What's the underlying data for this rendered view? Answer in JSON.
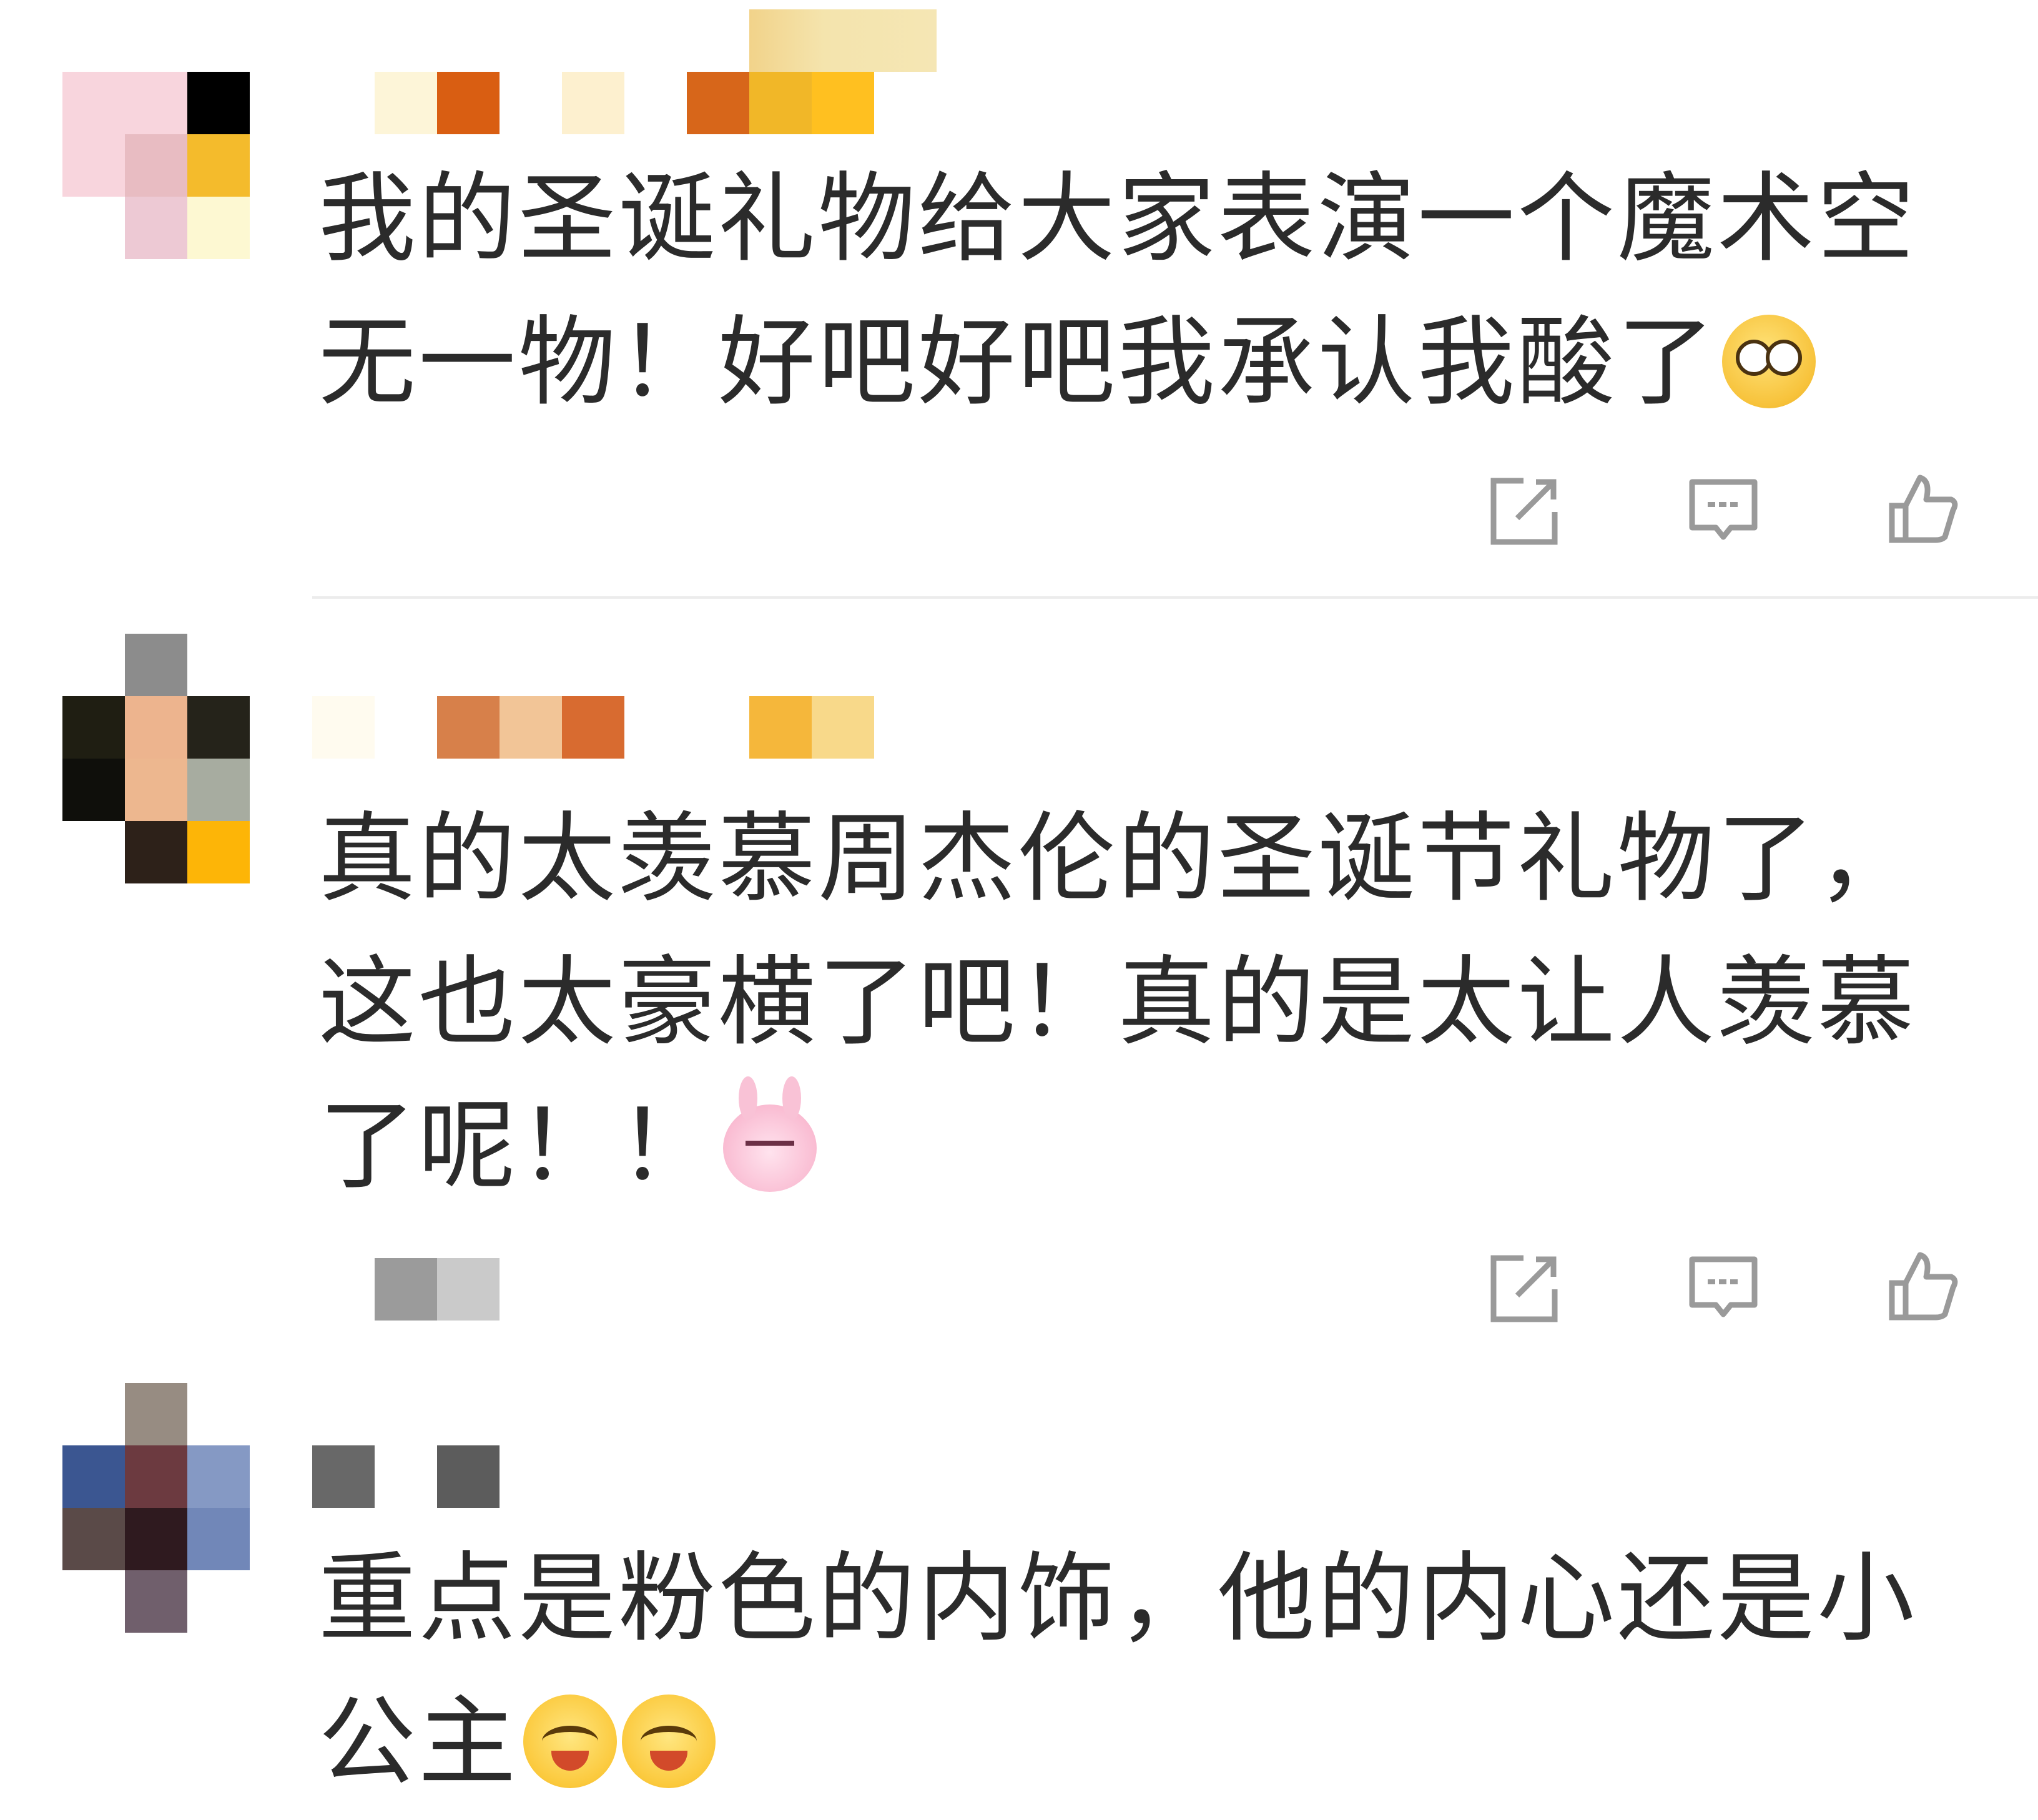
{
  "comments": [
    {
      "text": "我的圣诞礼物给大家表演一个魔术空无一物！好吧好吧我承认我酸了",
      "emoji": "sour-face-emoji",
      "avatar_colors": [
        "#f8d5dd",
        "#f8d5dd",
        "#000000",
        "#f8d5dd",
        "#e8bcc2",
        "#f4bb2c",
        "#ffffff",
        "#edc9d4",
        "#fdf8d2"
      ],
      "username_colors": [
        "#fdf5d8",
        "#d95e12",
        "#ffffff",
        "#fdf0cf",
        "#ffffff",
        "#d7661a",
        "#f1b728",
        "#ffc020"
      ]
    },
    {
      "text": "真的太羡慕周杰伦的圣诞节礼物了，这也太豪横了吧！真的是太让人羡慕了呢！！",
      "emoji": "pink-bunny-emoji",
      "avatar_colors": [
        "#ffffff",
        "#8c8c8c",
        "#ffffff",
        "#1f1e12",
        "#edb48e",
        "#25231a",
        "#0f0f0b",
        "#edb78f",
        "#a7aca0",
        "#ffffff",
        "#2d2119",
        "#fdb507"
      ],
      "username_colors": [
        "#fffbef",
        "#ffffff",
        "#d7804a",
        "#f2c597",
        "#d86b30",
        "#ffffff",
        "#ffffff",
        "#f5b73b",
        "#f8d98a"
      ]
    },
    {
      "text": "重点是粉色的内饰，他的内心还是小公主",
      "emojis": [
        "hugging-face-emoji",
        "hugging-face-emoji"
      ],
      "avatar_colors": [
        "#ffffff",
        "#978c82",
        "#ffffff",
        "#3b5691",
        "#6c3a40",
        "#8599c4",
        "#5a4a48",
        "#2f1a1f",
        "#7187b8",
        "#ffffff",
        "#705f6c",
        "#ffffff"
      ],
      "username_colors": [
        "#686868",
        "#ffffff",
        "#5c5c5c"
      ]
    }
  ],
  "icons": [
    "share-icon",
    "comment-icon",
    "like-icon"
  ],
  "colors": {
    "text": "#2b2b2b",
    "icon": "#9a9a9a",
    "divider": "#ececec"
  }
}
